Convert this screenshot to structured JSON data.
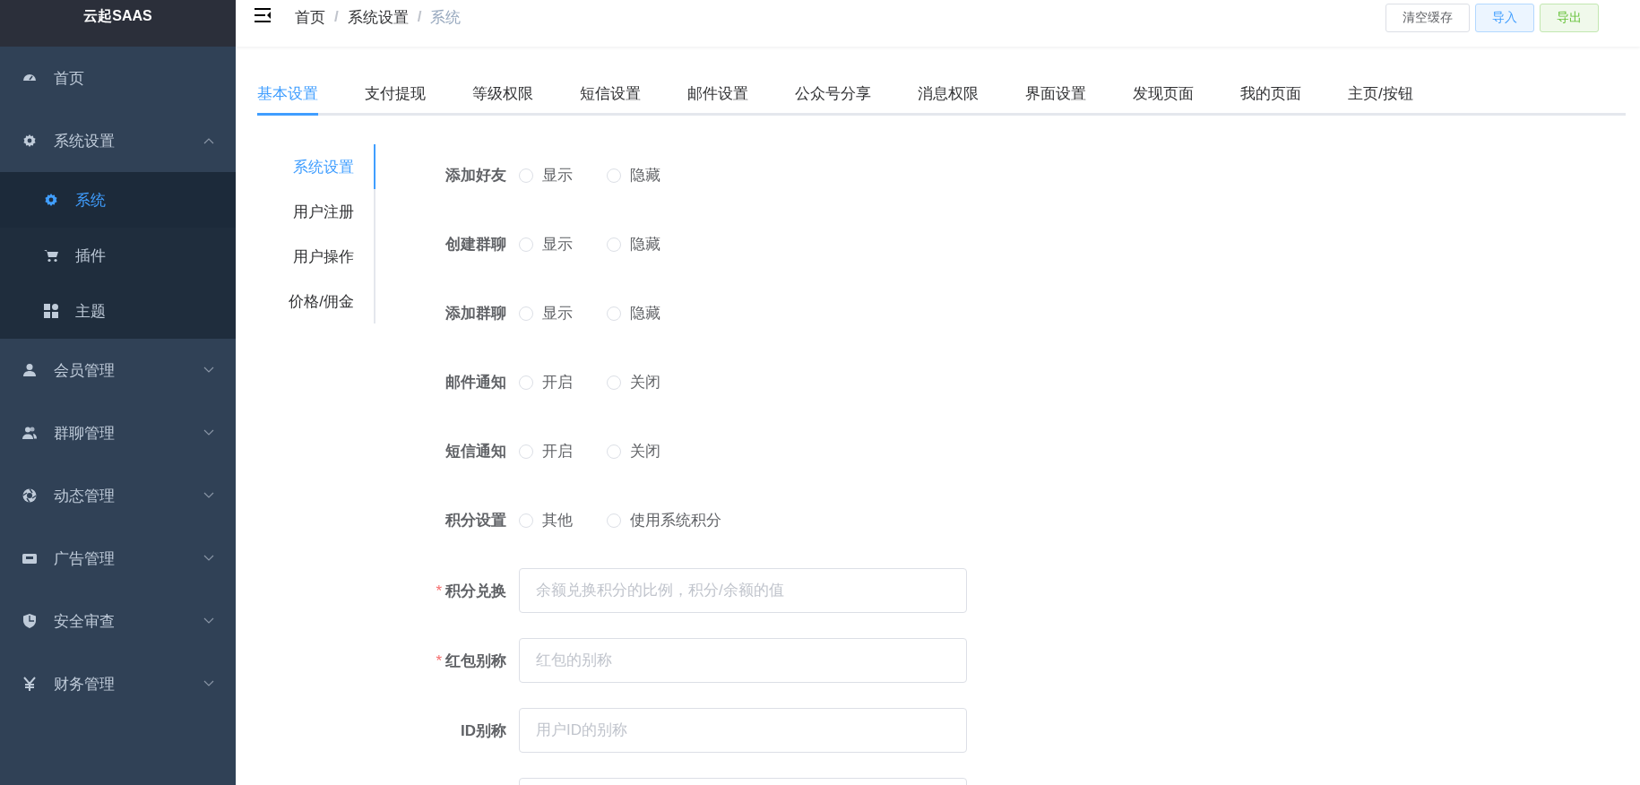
{
  "sidebar": {
    "logo": "云起SAAS",
    "items": [
      {
        "label": "首页"
      },
      {
        "label": "系统设置",
        "expanded": true,
        "children": [
          {
            "label": "系统",
            "selected": true
          },
          {
            "label": "插件",
            "selected": false
          },
          {
            "label": "主题",
            "selected": false
          }
        ]
      },
      {
        "label": "会员管理",
        "expanded": false
      },
      {
        "label": "群聊管理",
        "expanded": false
      },
      {
        "label": "动态管理",
        "expanded": false
      },
      {
        "label": "广告管理",
        "expanded": false
      },
      {
        "label": "安全审查",
        "expanded": false
      },
      {
        "label": "财务管理",
        "expanded": false
      }
    ]
  },
  "breadcrumb": {
    "separator": "/",
    "items": [
      "首页",
      "系统设置",
      "系统"
    ]
  },
  "header_buttons": [
    {
      "label": "清空缓存",
      "kind": "default"
    },
    {
      "label": "导入",
      "kind": "primary"
    },
    {
      "label": "导出",
      "kind": "success"
    }
  ],
  "tabs": [
    {
      "label": "基本设置",
      "selected": true
    },
    {
      "label": "支付提现",
      "selected": false
    },
    {
      "label": "等级权限",
      "selected": false
    },
    {
      "label": "短信设置",
      "selected": false
    },
    {
      "label": "邮件设置",
      "selected": false
    },
    {
      "label": "公众号分享",
      "selected": false
    },
    {
      "label": "消息权限",
      "selected": false
    },
    {
      "label": "界面设置",
      "selected": false
    },
    {
      "label": "发现页面",
      "selected": false
    },
    {
      "label": "我的页面",
      "selected": false
    },
    {
      "label": "主页/按钮",
      "selected": false
    }
  ],
  "side_tabs": [
    {
      "label": "系统设置",
      "selected": true
    },
    {
      "label": "用户注册",
      "selected": false
    },
    {
      "label": "用户操作",
      "selected": false
    },
    {
      "label": "价格/佣金",
      "selected": false
    }
  ],
  "radio_rows": [
    {
      "label": "添加好友",
      "options": [
        {
          "label": "显示",
          "checked": false
        },
        {
          "label": "隐藏",
          "checked": false
        }
      ]
    },
    {
      "label": "创建群聊",
      "options": [
        {
          "label": "显示",
          "checked": false
        },
        {
          "label": "隐藏",
          "checked": false
        }
      ]
    },
    {
      "label": "添加群聊",
      "options": [
        {
          "label": "显示",
          "checked": false
        },
        {
          "label": "隐藏",
          "checked": false
        }
      ]
    },
    {
      "label": "邮件通知",
      "options": [
        {
          "label": "开启",
          "checked": false
        },
        {
          "label": "关闭",
          "checked": false
        }
      ]
    },
    {
      "label": "短信通知",
      "options": [
        {
          "label": "开启",
          "checked": false
        },
        {
          "label": "关闭",
          "checked": false
        }
      ]
    },
    {
      "label": "积分设置",
      "options": [
        {
          "label": "其他",
          "checked": false
        },
        {
          "label": "使用系统积分",
          "checked": false
        }
      ]
    }
  ],
  "input_rows": [
    {
      "kind": "input",
      "required_mark": "*",
      "label": "积分兑换",
      "placeholder": "余额兑换积分的比例，积分/余额的值"
    },
    {
      "kind": "input",
      "required_mark": "*",
      "label": "红包别称",
      "placeholder": "红包的别称"
    },
    {
      "kind": "input",
      "label": "ID别称",
      "placeholder": "用户ID的别称"
    },
    {
      "kind": "input"
    }
  ]
}
